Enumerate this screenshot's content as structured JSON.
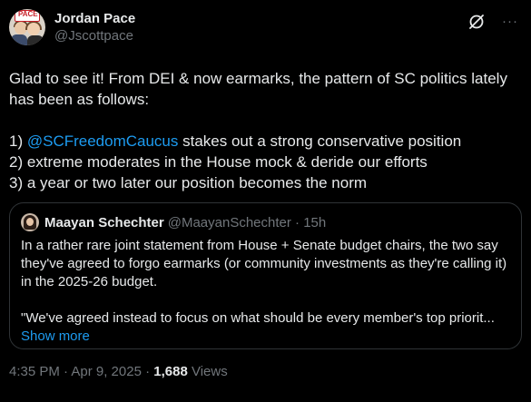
{
  "author": {
    "display_name": "Jordan Pace",
    "handle": "@Jscottpace",
    "avatar_sign_text": "PACE"
  },
  "icons": {
    "grok": "grok-icon",
    "more": "more-icon",
    "more_glyph": "···"
  },
  "tweet": {
    "intro": "Glad to see it! From DEI & now earmarks, the pattern of SC politics lately has been as follows:",
    "item1_prefix": "1) ",
    "item1_mention": "@SCFreedomCaucus",
    "item1_suffix": " stakes out a strong conservative position",
    "item2": "2) extreme moderates in the House mock & deride our efforts",
    "item3": "3) a year or two later our position becomes the norm"
  },
  "quote": {
    "display_name": "Maayan Schechter",
    "handle_time": "@MaayanSchechter · 15h",
    "paragraph1": "In a rather rare joint statement from House + Senate budget chairs, the two say they've agreed to forgo earmarks (or community investments as they're calling it) in the 2025-26 budget.",
    "paragraph2": "\"We've agreed instead to focus on what should be every member's top priorit...",
    "show_more": "Show more"
  },
  "meta": {
    "timestamp": "4:35 PM · Apr 9, 2025 · ",
    "views_count": "1,688",
    "views_label": " Views"
  },
  "colors": {
    "background": "#000000",
    "text": "#e7e9ea",
    "secondary": "#71767b",
    "link": "#1d9bf0",
    "border": "#2f3336"
  }
}
